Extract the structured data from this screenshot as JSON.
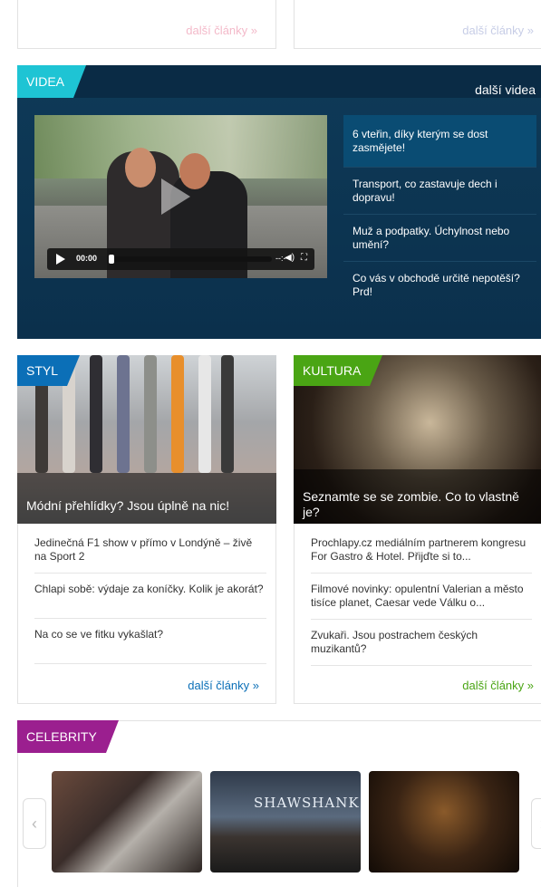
{
  "top": {
    "left_more": "další články »",
    "right_more": "další články »"
  },
  "videa": {
    "tag": "VIDEA",
    "more": "další videa",
    "player": {
      "time": "00:00",
      "duration": "--:--"
    },
    "items": [
      "6 vteřin, díky kterým se dost zasmějete!",
      "Transport, co zastavuje dech i dopravu!",
      "Muž a podpatky. Úchylnost nebo umění?",
      "Co vás v obchodě určitě nepotěší? Prd!"
    ]
  },
  "styl": {
    "tag": "STYL",
    "hero_caption": "Módní přehlídky? Jsou úplně na nic!",
    "articles": [
      "Jedinečná F1 show v přímo v Londýně – živě na Sport 2",
      "Chlapi sobě: výdaje za koníčky. Kolik je akorát?",
      "Na co se ve fitku vykašlat?"
    ],
    "more": "další články »"
  },
  "kultura": {
    "tag": "KULTURA",
    "hero_caption": "Seznamte se se zombie. Co to vlastně je?",
    "articles": [
      "Prochlapy.cz mediálním partnerem kongresu For Gastro & Hotel. Přijďte si to...",
      "Filmové novinky: opulentní Valerian a město tisíce planet, Caesar vede Válku o...",
      "Zvukaři. Jsou postrachem českých muzikantů?"
    ],
    "more": "další články »"
  },
  "celebrity": {
    "tag": "CELEBRITY",
    "poster_text": "SHAWSHANK",
    "prev": "‹",
    "next": "›"
  },
  "colors": {
    "videa_accent": "#1ec4d4",
    "videa_bg": "#0c3551",
    "styl_accent": "#0b6fb7",
    "kultura_accent": "#4aa514",
    "celebrity_accent": "#9b1f8f"
  }
}
